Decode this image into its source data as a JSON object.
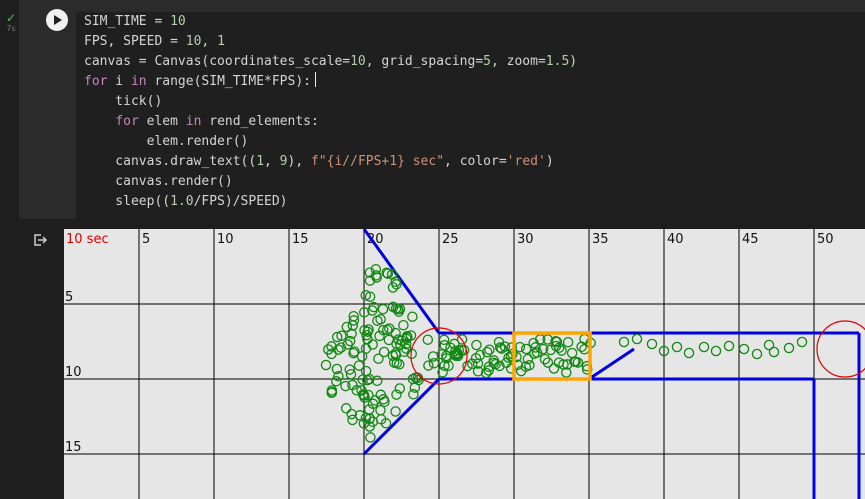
{
  "status": {
    "check_icon": "check-icon",
    "duration": "7s"
  },
  "code": {
    "lines": [
      "SIM_TIME = 10",
      "FPS, SPEED = 10, 1",
      "canvas = Canvas(coordinates_scale=10, grid_spacing=5, zoom=1.5)",
      "for i in range(SIM_TIME*FPS):",
      "    tick()",
      "    for elem in rend_elements:",
      "        elem.render()",
      "    canvas.draw_text((1, 9), f\"{i//FPS+1} sec\", color='red')",
      "    canvas.render()",
      "    sleep((1.0/FPS)/SPEED)"
    ]
  },
  "output": {
    "time_text": "10 sec",
    "x_labels": [
      "5",
      "10",
      "15",
      "20",
      "25",
      "30",
      "35",
      "40",
      "45",
      "50"
    ],
    "y_labels": [
      "5",
      "10",
      "15"
    ],
    "colors": {
      "background": "#e6e6e6",
      "grid": "#000000",
      "walls": "#0000e0",
      "particles": "#118811",
      "selection": "#ffa500",
      "circles": "#e00000",
      "time_text": "#e00000"
    }
  }
}
